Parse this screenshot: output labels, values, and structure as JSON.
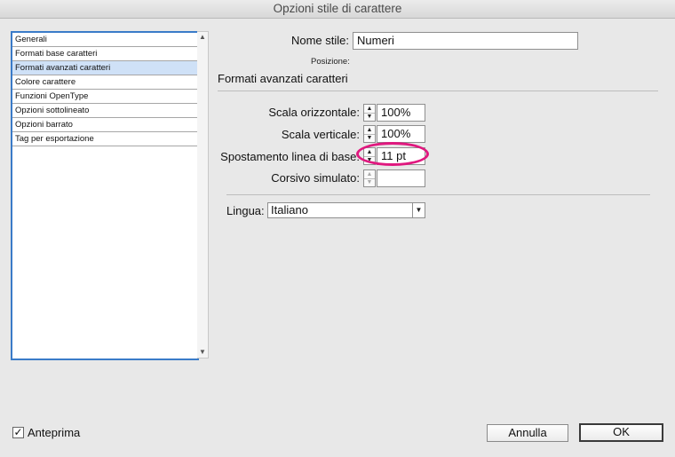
{
  "window": {
    "title": "Opzioni stile di carattere"
  },
  "sidebar": {
    "items": [
      {
        "label": "Generali",
        "selected": false
      },
      {
        "label": "Formati base caratteri",
        "selected": false
      },
      {
        "label": "Formati avanzati caratteri",
        "selected": true
      },
      {
        "label": "Colore carattere",
        "selected": false
      },
      {
        "label": "Funzioni OpenType",
        "selected": false
      },
      {
        "label": "Opzioni sottolineato",
        "selected": false
      },
      {
        "label": "Opzioni barrato",
        "selected": false
      },
      {
        "label": "Tag per esportazione",
        "selected": false
      }
    ]
  },
  "form": {
    "style_name_label": "Nome stile:",
    "style_name_value": "Numeri",
    "position_label": "Posizione:",
    "section_title": "Formati avanzati caratteri",
    "horizontal_scale_label": "Scala orizzontale:",
    "horizontal_scale_value": "100%",
    "vertical_scale_label": "Scala verticale:",
    "vertical_scale_value": "100%",
    "baseline_shift_label": "Spostamento linea di base:",
    "baseline_shift_value": "11 pt",
    "skew_label": "Corsivo simulato:",
    "skew_value": "",
    "language_label": "Lingua:",
    "language_value": "Italiano"
  },
  "footer": {
    "preview_label": "Anteprima",
    "preview_checked": true,
    "cancel_label": "Annulla",
    "ok_label": "OK"
  },
  "colors": {
    "highlight": "#e0187f",
    "selection": "#cfe1f7",
    "list_border": "#3a7bc8"
  }
}
